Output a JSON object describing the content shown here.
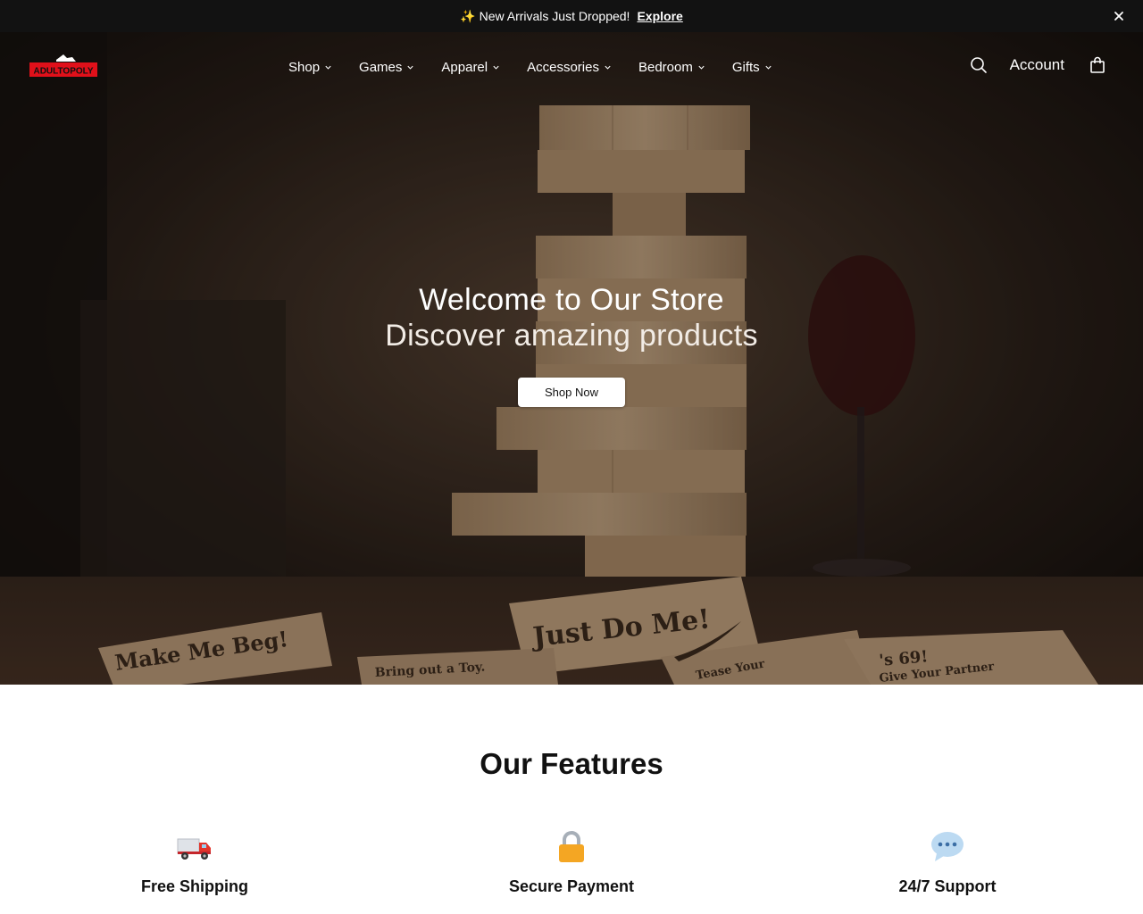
{
  "announcement": {
    "text": "New Arrivals Just Dropped!",
    "link": "Explore",
    "icon": "sparkles-icon",
    "close_icon": "close-icon"
  },
  "header": {
    "logo_text": "ADULTOPOLY",
    "nav": [
      {
        "label": "Shop"
      },
      {
        "label": "Games"
      },
      {
        "label": "Apparel"
      },
      {
        "label": "Accessories"
      },
      {
        "label": "Bedroom"
      },
      {
        "label": "Gifts"
      }
    ],
    "search_icon": "search-icon",
    "account_label": "Account",
    "cart_icon": "shopping-bag-icon"
  },
  "hero": {
    "title": "Welcome to Our Store",
    "subtitle": "Discover amazing products",
    "button_label": "Shop Now",
    "image_blocks": [
      "Make Me Beg!",
      "Just Do Me!",
      "Bring out a Toy.",
      "'s 69!",
      "Tease Your",
      "Give Your Partner"
    ]
  },
  "features": {
    "title": "Our Features",
    "items": [
      {
        "label": "Free Shipping",
        "icon": "truck-icon"
      },
      {
        "label": "Secure Payment",
        "icon": "lock-icon"
      },
      {
        "label": "24/7 Support",
        "icon": "speech-bubble-icon"
      }
    ]
  },
  "colors": {
    "announcement_bg": "#121212",
    "logo_red": "#e0101a",
    "button_bg": "#ffffff"
  }
}
